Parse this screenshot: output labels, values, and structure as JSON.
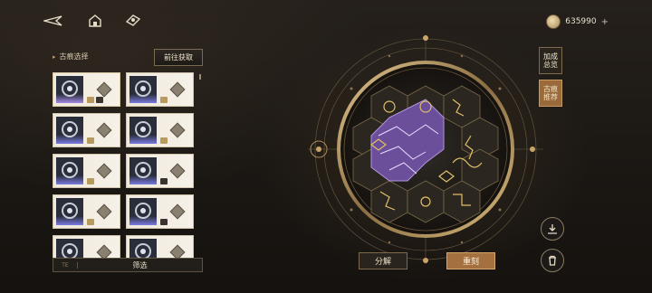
{
  "topbar": {
    "icons": [
      "back-arrow-icon",
      "home-icon",
      "map-icon"
    ],
    "currency": {
      "icon": "coin-icon",
      "amount": "635990",
      "plus": "+"
    }
  },
  "left_panel": {
    "title": "古痕选择",
    "goto_button": "前往获取",
    "filter_left": "TE",
    "filter_label": "筛选",
    "cards": [
      {
        "glow": "purple",
        "tags": [
          "gold",
          "dark"
        ],
        "selected": true
      },
      {
        "glow": "blue",
        "tags": [
          "gold"
        ],
        "selected": false
      },
      {
        "glow": "blue",
        "tags": [
          "gold"
        ],
        "selected": false
      },
      {
        "glow": "blue",
        "tags": [
          "gold"
        ],
        "selected": false
      },
      {
        "glow": "blue",
        "tags": [
          "gold"
        ],
        "selected": false
      },
      {
        "glow": "blue",
        "tags": [
          "dark"
        ],
        "selected": false
      },
      {
        "glow": "blue",
        "tags": [
          "gold"
        ],
        "selected": false
      },
      {
        "glow": "blue",
        "tags": [
          "dark"
        ],
        "selected": false
      },
      {
        "glow": "blue",
        "tags": [],
        "selected": false
      },
      {
        "glow": "blue",
        "tags": [],
        "selected": false
      }
    ]
  },
  "right_panel": {
    "bonus_overview": "加成\n总览",
    "recommend": "古痕\n推荐",
    "save_icon": "download-icon",
    "delete_icon": "trash-icon"
  },
  "actions": {
    "dismantle": "分解",
    "recast": "重刻"
  },
  "colors": {
    "accent_gold": "#c9a56a",
    "purple_glow": "#7c5bb8",
    "button_orange": "#a5703f"
  }
}
